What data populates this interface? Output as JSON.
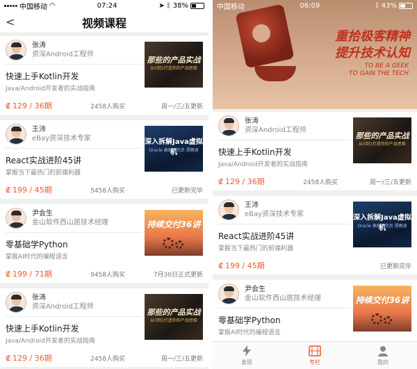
{
  "left": {
    "status": {
      "carrier": "中国移动",
      "time": "07:24",
      "battery": "38%",
      "battery_level": 0.38
    },
    "nav": {
      "title": "视频课程"
    },
    "courses": [
      {
        "author": "张涛",
        "role": "资深Android工程师",
        "title": "快速上手Kotlin开发",
        "subtitle": "Java/Android开发者的实战指南",
        "price": "129 / 36期",
        "sales": "2458人购买",
        "schedule": "周一/三/五更新",
        "thumb": {
          "line1": "那些的产品实战",
          "line2": "从0到1打造你的产品思维"
        }
      },
      {
        "author": "王沛",
        "role": "eBay资深技术专家",
        "title": "React实战进阶45讲",
        "subtitle": "掌握当下最热门的前端利器",
        "price": "199 / 45期",
        "sales": "5458人购买",
        "schedule": "已更新完毕",
        "thumb": {
          "line1": "深入拆解Java虚拟机",
          "line2": "Oracle 高级研究员 郑雨迪"
        }
      },
      {
        "author": "尹会生",
        "role": "金山软件西山居技术经理",
        "title": "零基础学Python",
        "subtitle": "掌握AI时代的编程语言",
        "price": "199 / 71期",
        "sales": "9458人购买",
        "schedule": "7月30日正式更新",
        "thumb": {
          "line1": "持续交付36讲",
          "line2": ""
        }
      },
      {
        "author": "张涛",
        "role": "资深Android工程师",
        "title": "快速上手Kotlin开发",
        "subtitle": "Java/Android开发者的实战指南",
        "price": "129 / 36期",
        "sales": "2458人购买",
        "schedule": "周一/三/五更新",
        "thumb": {
          "line1": "那些的产品实战",
          "line2": "从0到1打造你的产品思维"
        }
      }
    ]
  },
  "right": {
    "status": {
      "carrier": "中国移动",
      "time": "06:09",
      "battery": "43%",
      "battery_level": 0.43
    },
    "banner": {
      "line1": "重拾极客精神",
      "line2": "提升技术认知",
      "en1": "TO BE A GEEK",
      "en2": "TO GAIN THE TECH"
    },
    "courses": [
      {
        "author": "张涛",
        "role": "资深Android工程师",
        "title": "快速上手Kotlin开发",
        "subtitle": "Java/Android开发者的实战指南",
        "price": "129 / 36期",
        "sales": "2458人购买",
        "schedule": "周一/三/五更新",
        "thumb": {
          "line1": "那些的产品实战",
          "line2": "从0到1打造你的产品思维"
        }
      },
      {
        "author": "王沛",
        "role": "eBay资深技术专家",
        "title": "React实战进阶45讲",
        "subtitle": "掌握当下最热门的前端利器",
        "price": "199 / 45期",
        "sales": "",
        "schedule": "已更新完毕",
        "thumb": {
          "line1": "深入拆解Java虚拟机",
          "line2": "Oracle 高级研究员 郑雨迪"
        }
      },
      {
        "author": "尹会生",
        "role": "金山软件西山居技术经理",
        "title": "零基础学Python",
        "subtitle": "掌握AI时代的编程语言",
        "price": "199 / 71期",
        "sales": "9458人购买",
        "schedule": "7月30日正式更新",
        "thumb": {
          "line1": "持续交付36讲",
          "line2": ""
        }
      }
    ],
    "tabs": [
      {
        "label": "发现",
        "icon": "lightning-icon",
        "active": false
      },
      {
        "label": "专栏",
        "icon": "film-icon",
        "active": true
      },
      {
        "label": "我的",
        "icon": "user-icon",
        "active": false
      }
    ]
  },
  "colors": {
    "accent": "#ee5a2c",
    "banner_text": "#c0321d"
  }
}
